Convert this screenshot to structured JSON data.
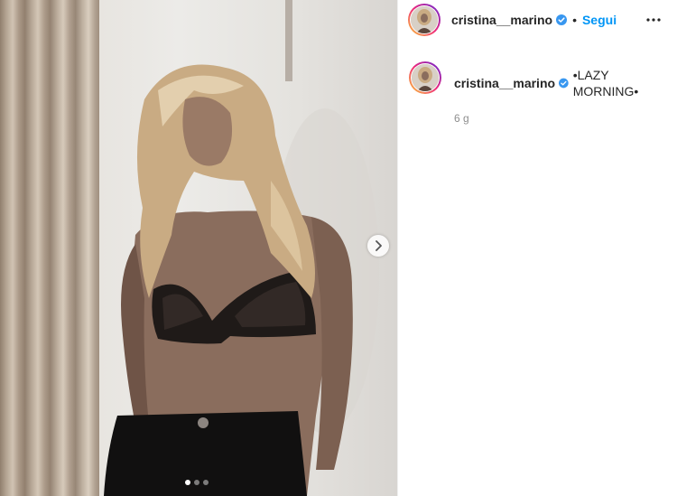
{
  "post": {
    "username": "cristina__marino",
    "follow_separator": "•",
    "follow_label": "Segui",
    "caption": "•LAZY MORNING•",
    "time_ago": "6 g"
  },
  "media": {
    "carousel_count": 3,
    "active_index": 0
  },
  "colors": {
    "follow_blue": "#0095f6",
    "verified_blue": "#3897f0"
  },
  "icons": [
    "verified-badge-icon",
    "more-options-icon",
    "chevron-right-icon"
  ]
}
